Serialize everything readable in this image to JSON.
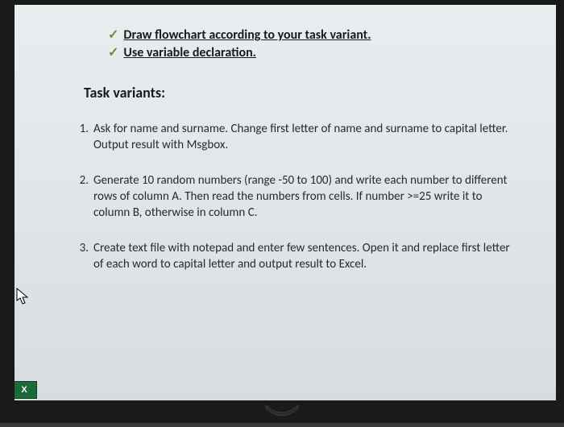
{
  "checklist": {
    "items": [
      {
        "label": "Draw flowchart according to your task variant."
      },
      {
        "label": "Use variable declaration."
      }
    ]
  },
  "section": {
    "title": "Task variants:"
  },
  "tasks": [
    {
      "text": "Ask for name and surname. Change first letter of name and surname to capital letter. Output result with Msgbox."
    },
    {
      "text": "Generate 10 random numbers (range -50 to 100) and write each number to different rows of column A. Then read the numbers from cells. If number >=25 write it to column B, otherwise in column C."
    },
    {
      "text": "Create text file with notepad and enter few sentences. Open it and replace first letter of each word to capital letter and output result to Excel."
    }
  ],
  "taskbar": {
    "excel_label": "X"
  }
}
